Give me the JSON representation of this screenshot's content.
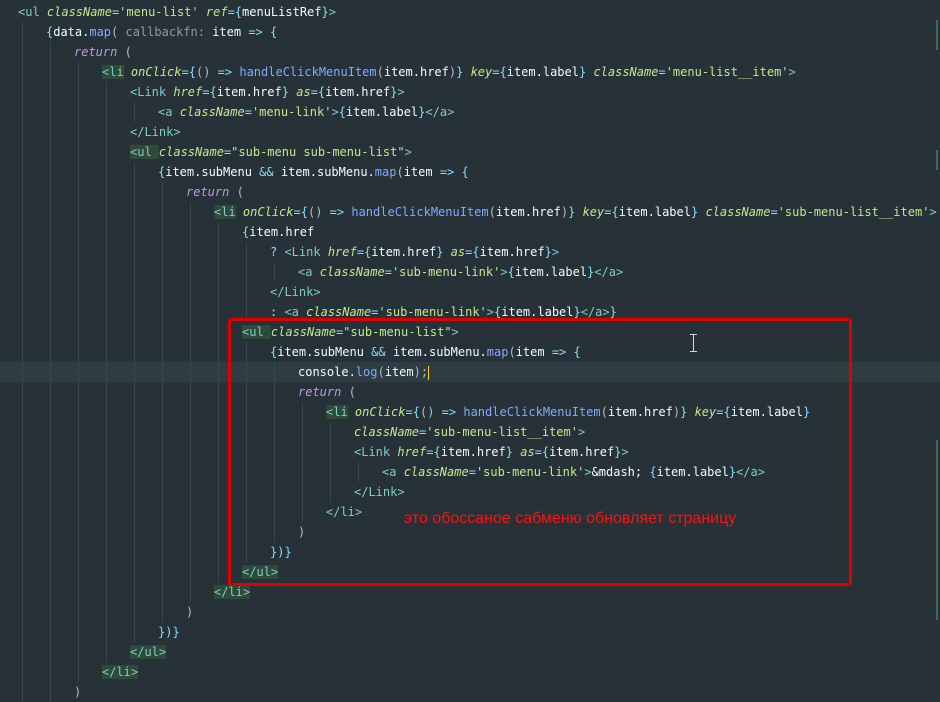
{
  "annotation": "это обоссаное сабменю обновляет страницу",
  "code_lines": [
    {
      "indent": 0,
      "tokens": [
        [
          "tag",
          "<ul "
        ],
        [
          "attr",
          "className"
        ],
        [
          "op",
          "="
        ],
        [
          "str",
          "'menu-list' "
        ],
        [
          "attr",
          "ref"
        ],
        [
          "op",
          "="
        ],
        [
          "brace",
          "{"
        ],
        [
          "var",
          "menuListRef"
        ],
        [
          "brace",
          "}"
        ],
        [
          "tag",
          ">"
        ]
      ]
    },
    {
      "indent": 1,
      "tokens": [
        [
          "brace",
          "{"
        ],
        [
          "var",
          "data."
        ],
        [
          "fn",
          "map"
        ],
        [
          "plain",
          "( "
        ],
        [
          "hint",
          "callbackfn: "
        ],
        [
          "var",
          "item "
        ],
        [
          "op",
          "=> "
        ],
        [
          "brace",
          "{"
        ]
      ]
    },
    {
      "indent": 2,
      "tokens": [
        [
          "kw",
          "return "
        ],
        [
          "plain",
          "("
        ]
      ]
    },
    {
      "indent": 3,
      "tokens": [
        [
          "tagm",
          "<li"
        ],
        [
          "tag",
          " "
        ],
        [
          "attr",
          "onClick"
        ],
        [
          "op",
          "="
        ],
        [
          "brace",
          "{"
        ],
        [
          "plain",
          "() "
        ],
        [
          "op",
          "=> "
        ],
        [
          "fn",
          "handleClickMenuItem"
        ],
        [
          "plain",
          "("
        ],
        [
          "var",
          "item.href"
        ],
        [
          "plain",
          ")"
        ],
        [
          "brace",
          "} "
        ],
        [
          "attr",
          "key"
        ],
        [
          "op",
          "="
        ],
        [
          "brace",
          "{"
        ],
        [
          "var",
          "item.label"
        ],
        [
          "brace",
          "} "
        ],
        [
          "attr",
          "className"
        ],
        [
          "op",
          "="
        ],
        [
          "str",
          "'menu-list__item'"
        ],
        [
          "tag",
          ">"
        ]
      ]
    },
    {
      "indent": 4,
      "tokens": [
        [
          "tag",
          "<Link "
        ],
        [
          "attr",
          "href"
        ],
        [
          "op",
          "="
        ],
        [
          "brace",
          "{"
        ],
        [
          "var",
          "item.href"
        ],
        [
          "brace",
          "} "
        ],
        [
          "attr",
          "as"
        ],
        [
          "op",
          "="
        ],
        [
          "brace",
          "{"
        ],
        [
          "var",
          "item.href"
        ],
        [
          "brace",
          "}"
        ],
        [
          "tag",
          ">"
        ]
      ]
    },
    {
      "indent": 5,
      "tokens": [
        [
          "tag",
          "<a "
        ],
        [
          "attr",
          "className"
        ],
        [
          "op",
          "="
        ],
        [
          "str",
          "'menu-link'"
        ],
        [
          "tag",
          ">"
        ],
        [
          "brace",
          "{"
        ],
        [
          "var",
          "item.label"
        ],
        [
          "brace",
          "}"
        ],
        [
          "tag",
          "</a>"
        ]
      ]
    },
    {
      "indent": 4,
      "tokens": [
        [
          "tag",
          "</Link>"
        ]
      ]
    },
    {
      "indent": 4,
      "tokens": [
        [
          "tagm",
          "<ul "
        ],
        [
          "attr",
          "className"
        ],
        [
          "op",
          "="
        ],
        [
          "str",
          "\"sub-menu sub-menu-list\""
        ],
        [
          "tag",
          ">"
        ]
      ]
    },
    {
      "indent": 5,
      "tokens": [
        [
          "brace",
          "{"
        ],
        [
          "var",
          "item.subMenu "
        ],
        [
          "op",
          "&& "
        ],
        [
          "var",
          "item.subMenu."
        ],
        [
          "fn",
          "map"
        ],
        [
          "plain",
          "("
        ],
        [
          "var",
          "item "
        ],
        [
          "op",
          "=> "
        ],
        [
          "brace",
          "{"
        ]
      ]
    },
    {
      "indent": 6,
      "tokens": [
        [
          "kw",
          "return "
        ],
        [
          "plain",
          "("
        ]
      ]
    },
    {
      "indent": 7,
      "tokens": [
        [
          "tagm",
          "<li"
        ],
        [
          "tag",
          " "
        ],
        [
          "attr",
          "onClick"
        ],
        [
          "op",
          "="
        ],
        [
          "brace",
          "{"
        ],
        [
          "plain",
          "() "
        ],
        [
          "op",
          "=> "
        ],
        [
          "fn",
          "handleClickMenuItem"
        ],
        [
          "plain",
          "("
        ],
        [
          "var",
          "item.href"
        ],
        [
          "plain",
          ")"
        ],
        [
          "brace",
          "} "
        ],
        [
          "attr",
          "key"
        ],
        [
          "op",
          "="
        ],
        [
          "brace",
          "{"
        ],
        [
          "var",
          "item.label"
        ],
        [
          "brace",
          "} "
        ],
        [
          "attr",
          "className"
        ],
        [
          "op",
          "="
        ],
        [
          "str",
          "'sub-menu-list__item'"
        ],
        [
          "tag",
          ">"
        ]
      ]
    },
    {
      "indent": 8,
      "tokens": [
        [
          "brace",
          "{"
        ],
        [
          "var",
          "item.href"
        ]
      ]
    },
    {
      "indent": 9,
      "tokens": [
        [
          "op",
          "? "
        ],
        [
          "tag",
          "<Link "
        ],
        [
          "attr",
          "href"
        ],
        [
          "op",
          "="
        ],
        [
          "brace",
          "{"
        ],
        [
          "var",
          "item.href"
        ],
        [
          "brace",
          "} "
        ],
        [
          "attr",
          "as"
        ],
        [
          "op",
          "="
        ],
        [
          "brace",
          "{"
        ],
        [
          "var",
          "item.href"
        ],
        [
          "brace",
          "}"
        ],
        [
          "tag",
          ">"
        ]
      ]
    },
    {
      "indent": 10,
      "tokens": [
        [
          "tag",
          "<a "
        ],
        [
          "attr",
          "className"
        ],
        [
          "op",
          "="
        ],
        [
          "str",
          "'sub-menu-link'"
        ],
        [
          "tag",
          ">"
        ],
        [
          "brace",
          "{"
        ],
        [
          "var",
          "item.label"
        ],
        [
          "brace",
          "}"
        ],
        [
          "tag",
          "</a>"
        ]
      ]
    },
    {
      "indent": 9,
      "tokens": [
        [
          "tag",
          "</Link>"
        ]
      ]
    },
    {
      "indent": 9,
      "tokens": [
        [
          "op",
          ": "
        ],
        [
          "tag",
          "<a "
        ],
        [
          "attr",
          "className"
        ],
        [
          "op",
          "="
        ],
        [
          "str",
          "'sub-menu-link'"
        ],
        [
          "tag",
          ">"
        ],
        [
          "brace",
          "{"
        ],
        [
          "var",
          "item.label"
        ],
        [
          "brace",
          "}"
        ],
        [
          "tag",
          "</a>"
        ],
        [
          "brace",
          "}"
        ]
      ]
    },
    {
      "indent": 8,
      "tokens": [
        [
          "tagm",
          "<ul "
        ],
        [
          "attr",
          "className"
        ],
        [
          "op",
          "="
        ],
        [
          "str",
          "\"sub-menu-list\""
        ],
        [
          "tag",
          ">"
        ]
      ]
    },
    {
      "indent": 9,
      "tokens": [
        [
          "brace",
          "{"
        ],
        [
          "var",
          "item.subMenu "
        ],
        [
          "op",
          "&& "
        ],
        [
          "var",
          "item.subMenu."
        ],
        [
          "fn",
          "map"
        ],
        [
          "plain",
          "("
        ],
        [
          "var",
          "item "
        ],
        [
          "op",
          "=> "
        ],
        [
          "brace",
          "{"
        ]
      ]
    },
    {
      "indent": 10,
      "current": true,
      "tokens": [
        [
          "var",
          "console."
        ],
        [
          "fn",
          "log"
        ],
        [
          "plain",
          "("
        ],
        [
          "var",
          "item"
        ],
        [
          "plain",
          ");"
        ]
      ]
    },
    {
      "indent": 10,
      "tokens": [
        [
          "kw",
          "return "
        ],
        [
          "plain",
          "("
        ]
      ]
    },
    {
      "indent": 11,
      "tokens": [
        [
          "tagm",
          "<li"
        ],
        [
          "tag",
          " "
        ],
        [
          "attr",
          "onClick"
        ],
        [
          "op",
          "="
        ],
        [
          "brace",
          "{"
        ],
        [
          "plain",
          "() "
        ],
        [
          "op",
          "=> "
        ],
        [
          "fn",
          "handleClickMenuItem"
        ],
        [
          "plain",
          "("
        ],
        [
          "var",
          "item.href"
        ],
        [
          "plain",
          ")"
        ],
        [
          "brace",
          "} "
        ],
        [
          "attr",
          "key"
        ],
        [
          "op",
          "="
        ],
        [
          "brace",
          "{"
        ],
        [
          "var",
          "item.label"
        ],
        [
          "brace",
          "}"
        ]
      ]
    },
    {
      "indent": 12,
      "tokens": [
        [
          "attr",
          "className"
        ],
        [
          "op",
          "="
        ],
        [
          "str",
          "'sub-menu-list__item'"
        ],
        [
          "tag",
          ">"
        ]
      ]
    },
    {
      "indent": 12,
      "tokens": [
        [
          "tag",
          "<Link "
        ],
        [
          "attr",
          "href"
        ],
        [
          "op",
          "="
        ],
        [
          "brace",
          "{"
        ],
        [
          "var",
          "item.href"
        ],
        [
          "brace",
          "} "
        ],
        [
          "attr",
          "as"
        ],
        [
          "op",
          "="
        ],
        [
          "brace",
          "{"
        ],
        [
          "var",
          "item.href"
        ],
        [
          "brace",
          "}"
        ],
        [
          "tag",
          ">"
        ]
      ]
    },
    {
      "indent": 13,
      "tokens": [
        [
          "tag",
          "<a "
        ],
        [
          "attr",
          "className"
        ],
        [
          "op",
          "="
        ],
        [
          "str",
          "'sub-menu-link'"
        ],
        [
          "tag",
          ">"
        ],
        [
          "var",
          "&mdash; "
        ],
        [
          "brace",
          "{"
        ],
        [
          "var",
          "item.label"
        ],
        [
          "brace",
          "}"
        ],
        [
          "tag",
          "</a>"
        ]
      ]
    },
    {
      "indent": 12,
      "tokens": [
        [
          "tag",
          "</Link>"
        ]
      ]
    },
    {
      "indent": 11,
      "tokens": [
        [
          "tag",
          "</li>"
        ]
      ]
    },
    {
      "indent": 10,
      "tokens": [
        [
          "plain",
          ")"
        ]
      ]
    },
    {
      "indent": 9,
      "tokens": [
        [
          "brace",
          "})}"
        ]
      ]
    },
    {
      "indent": 8,
      "tokens": [
        [
          "tagm",
          "</ul>"
        ]
      ]
    },
    {
      "indent": 7,
      "tokens": [
        [
          "tagm",
          "</li>"
        ]
      ]
    },
    {
      "indent": 6,
      "tokens": [
        [
          "plain",
          ")"
        ]
      ]
    },
    {
      "indent": 5,
      "tokens": [
        [
          "brace",
          "})}"
        ]
      ]
    },
    {
      "indent": 4,
      "tokens": [
        [
          "tagm",
          "</ul>"
        ]
      ]
    },
    {
      "indent": 3,
      "tokens": [
        [
          "tagm",
          "</li>"
        ]
      ]
    },
    {
      "indent": 2,
      "tokens": [
        [
          "plain",
          ")"
        ]
      ]
    }
  ]
}
